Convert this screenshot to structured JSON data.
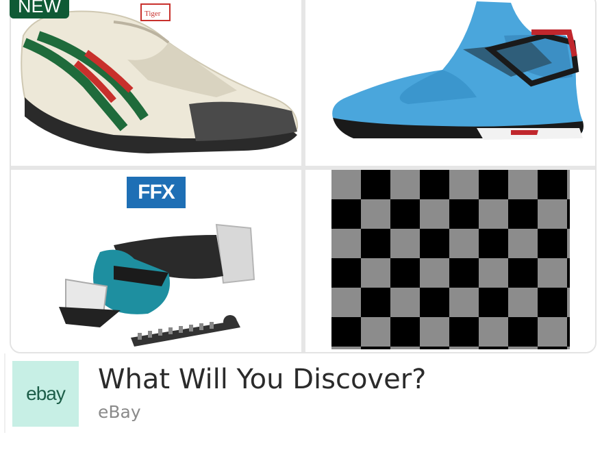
{
  "badges": {
    "new_label": "NEW"
  },
  "tiles": [
    {
      "name": "onitsuka-sneaker-product"
    },
    {
      "name": "jordan-sneaker-product"
    },
    {
      "name": "makita-shear-product",
      "retailer_logo": "FFX"
    },
    {
      "name": "checkerboard-product"
    }
  ],
  "ad": {
    "logo_text": "ebay",
    "headline": "What Will You Discover?",
    "advertiser": "eBay"
  },
  "colors": {
    "badge_bg": "#0f5a35",
    "logo_bg": "#c7efe5",
    "ffx_blue": "#1e6fb5"
  }
}
